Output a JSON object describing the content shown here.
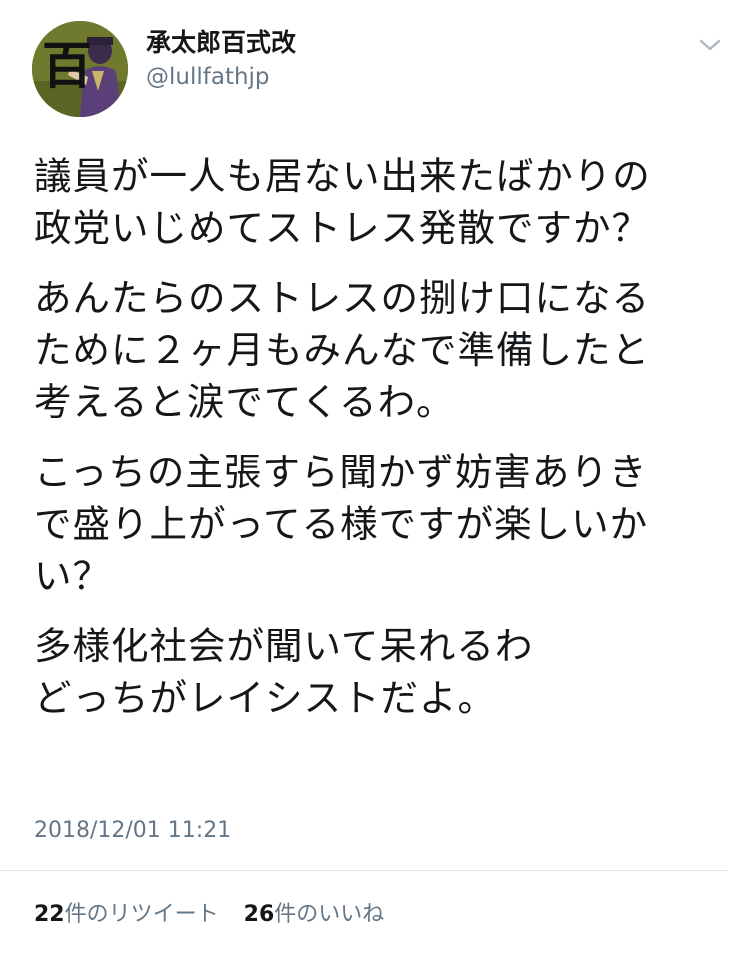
{
  "user": {
    "display_name": "承太郎百式改",
    "handle": "@lullfathjp",
    "avatar_glyph": "百"
  },
  "tweet": {
    "paragraphs": [
      [
        "議員が一人も居ない出来たばかりの",
        "政党いじめてストレス発散ですか？"
      ],
      [
        "あんたらのストレスの捌け口になる",
        "ために２ヶ月もみんなで準備したと",
        "考えると涙でてくるわ。"
      ],
      [
        "こっちの主張すら聞かず妨害ありき",
        "で盛り上がってる様ですが楽しいか",
        "い？"
      ],
      [
        "多様化社会が聞いて呆れるわ",
        "どっちがレイシストだよ。"
      ]
    ],
    "timestamp": "2018/12/01 11:21"
  },
  "stats": {
    "retweet_count": "22",
    "retweet_label": "件のリツイート",
    "like_count": "26",
    "like_label": "件のいいね"
  },
  "colors": {
    "text_primary": "#14171a",
    "text_secondary": "#657786",
    "divider": "#e1e8ed",
    "avatar_bg": "#6f7a2e"
  },
  "icons": {
    "menu": "chevron-down-icon"
  }
}
